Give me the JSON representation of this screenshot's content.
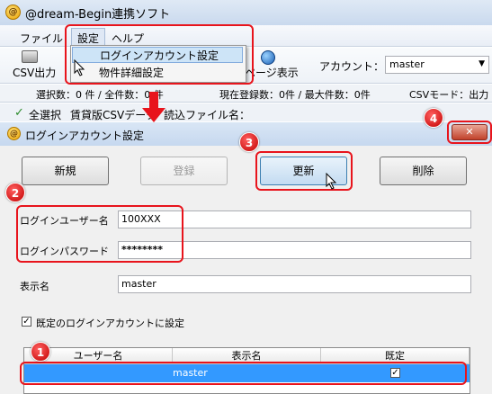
{
  "main_window": {
    "title": "@dream-Begin連携ソフト",
    "app_icon_glyph": "@",
    "menu": [
      "ファイル",
      "設定",
      "ヘルプ"
    ],
    "settings_menu": {
      "items": [
        "ログインアカウント設定",
        "物件詳細設定"
      ]
    },
    "toolbar": {
      "csv_output": "CSV出力",
      "page_view": "ページ表示",
      "account_label": "アカウント：",
      "account_value": "master"
    },
    "status": {
      "selected": "選択数：0 件 / 全件数：0 件",
      "current": "現在登録数：0件 / 最大件数：0件",
      "csv_mode": "CSVモード：出力"
    },
    "subtoolbar": {
      "select_all": "全選択",
      "rental_csv": "賃貸版CSVデータ",
      "read_file": "読込ファイル名："
    }
  },
  "dialog": {
    "title": "ログインアカウント設定",
    "buttons": {
      "new": "新規",
      "register": "登録",
      "update": "更新",
      "delete": "削除"
    },
    "fields": {
      "login_user_label": "ログインユーザー名",
      "login_user_value": "100XXX",
      "login_password_label": "ログインパスワード",
      "login_password_value": "********",
      "display_name_label": "表示名",
      "display_name_value": "master"
    },
    "default_checkbox_label": "既定のログインアカウントに設定",
    "grid": {
      "headers": [
        "ユーザー名",
        "表示名",
        "既定"
      ],
      "rows": [
        {
          "user": "",
          "display": "master",
          "default": "✓"
        }
      ]
    },
    "close_glyph": "✕"
  },
  "annotations": {
    "badges": [
      "1",
      "2",
      "3",
      "4"
    ],
    "accent_color": "#e8141c",
    "selection_color": "#3399ff"
  }
}
